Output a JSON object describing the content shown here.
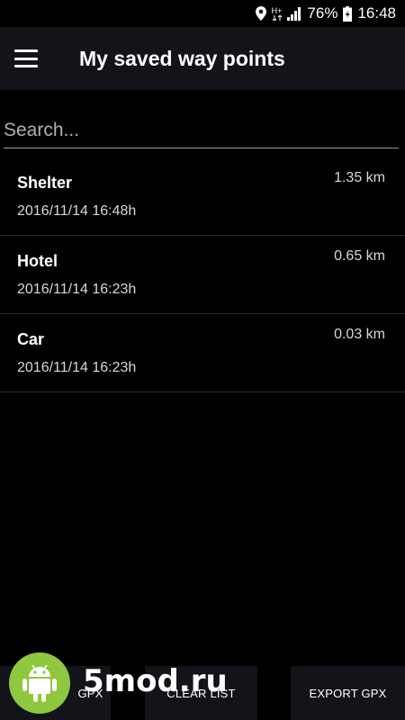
{
  "status_bar": {
    "location_icon": "location-pin-icon",
    "network_type": "H+",
    "signal_icon": "signal-bars-icon",
    "battery_percent": "76%",
    "battery_icon": "battery-icon",
    "time": "16:48"
  },
  "app_bar": {
    "menu_icon": "hamburger-menu-icon",
    "title": "My saved way points"
  },
  "search": {
    "placeholder": "Search...",
    "value": ""
  },
  "waypoints": [
    {
      "name": "Shelter",
      "date": "2016/11/14 16:48h",
      "distance": "1.35 km"
    },
    {
      "name": "Hotel",
      "date": "2016/11/14 16:23h",
      "distance": "0.65 km"
    },
    {
      "name": "Car",
      "date": "2016/11/14 16:23h",
      "distance": "0.03 km"
    }
  ],
  "bottom_bar": {
    "import_label": "GPX",
    "clear_label": "CLEAR LIST",
    "export_label": "EXPORT GPX"
  },
  "watermark": {
    "logo_icon": "android-robot-icon",
    "text": "5mod.ru"
  },
  "colors": {
    "background": "#000000",
    "app_bar": "#121419",
    "watermark_green": "#8fc73e"
  }
}
